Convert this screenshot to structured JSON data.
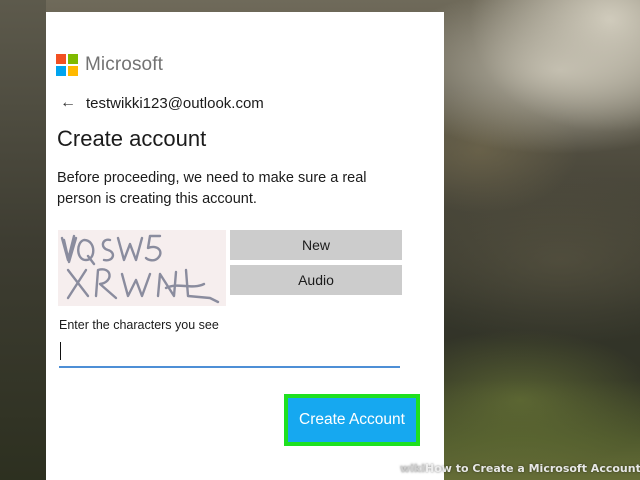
{
  "brand": {
    "name": "Microsoft",
    "colors": {
      "red": "#f25022",
      "green": "#7fba00",
      "blue": "#00a4ef",
      "yellow": "#ffb900"
    }
  },
  "identity": {
    "back_icon": "arrow-left-icon",
    "email": "testwikki123@outlook.com"
  },
  "page": {
    "title": "Create account",
    "description": "Before proceeding, we need to make sure a real person is creating this account."
  },
  "captcha": {
    "text": "VQSW5 XRWNL",
    "new_label": "New",
    "audio_label": "Audio"
  },
  "field": {
    "label": "Enter the characters you see",
    "value": "",
    "accent": "#4d8fd6"
  },
  "submit": {
    "label": "Create Account",
    "color": "#16a8f0",
    "highlight": "#1fe01f"
  },
  "watermark": {
    "prefix": "wiki",
    "text": "How to Create a Microsoft Account"
  }
}
